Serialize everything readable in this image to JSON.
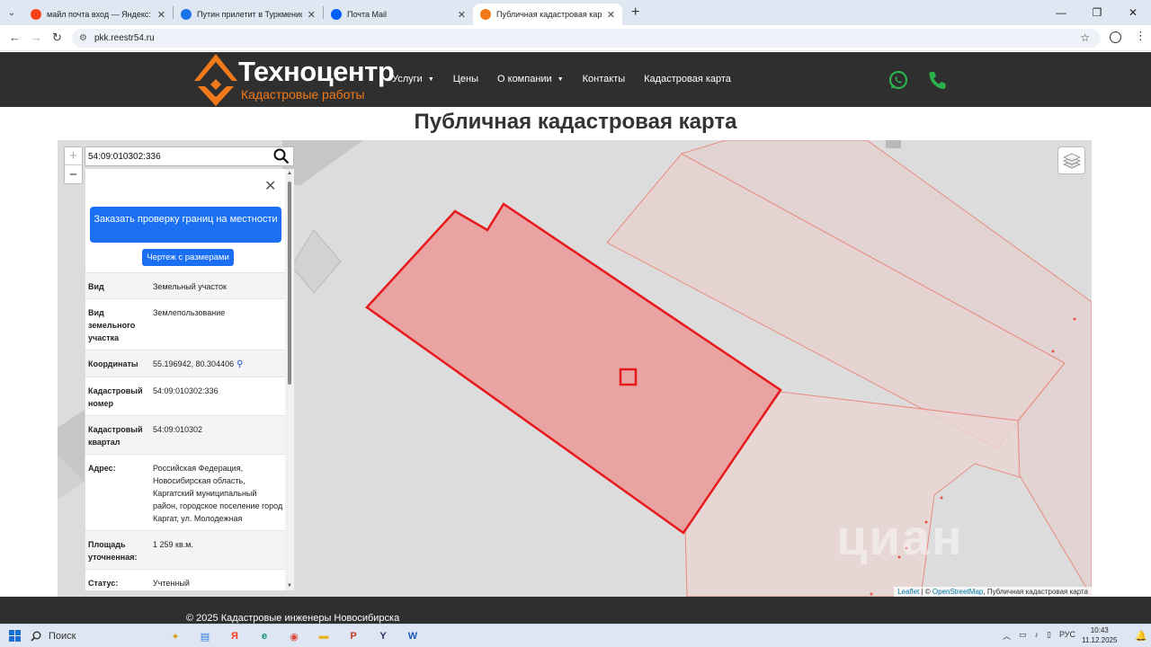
{
  "browser": {
    "tabs": [
      {
        "title": "майл почта вход — Яндекс: на",
        "icon": "yandex-icon",
        "color": "#fc3f1d"
      },
      {
        "title": "Путин прилетит в Туркменис",
        "icon": "news-icon",
        "color": "#1a73e8"
      },
      {
        "title": "Почта Mail",
        "icon": "mail-icon",
        "color": "#005ff9"
      },
      {
        "title": "Публичная кадастровая карта",
        "icon": "site-icon",
        "color": "#f07a1a",
        "active": true
      }
    ],
    "new_tab": "+",
    "url": "pkk.reestr54.ru"
  },
  "site": {
    "brand": "Техноцентр",
    "brand_sub": "Кадастровые работы",
    "accent": "#f07a1a",
    "menu": [
      {
        "label": "Услуги",
        "dropdown": true
      },
      {
        "label": "Цены",
        "dropdown": false
      },
      {
        "label": "О компании",
        "dropdown": true
      },
      {
        "label": "Контакты",
        "dropdown": false
      },
      {
        "label": "Кадастровая карта",
        "dropdown": false
      }
    ],
    "contact_color": "#2bb24c"
  },
  "page": {
    "title": "Публичная кадастровая карта"
  },
  "map": {
    "search_value": "54:09:010302:336",
    "zoom_in": "+",
    "zoom_out": "−",
    "panel": {
      "order_button": "Заказать проверку границ на местности",
      "drawing_button": "Чертеж с размерами",
      "rows": [
        {
          "key": "Вид",
          "value": "Земельный участок"
        },
        {
          "key": "Вид земельного участка",
          "value": "Землепользование"
        },
        {
          "key": "Координаты",
          "value": "55.196942, 80.304406"
        },
        {
          "key": "Кадастровый номер",
          "value": "54:09:010302:336"
        },
        {
          "key": "Кадастровый квартал",
          "value": "54:09:010302"
        },
        {
          "key": "Адрес:",
          "value": "Российская Федерация, Новосибирская область, Каргатский муниципальный район, городское поселение город Каргат, ул. Молодежная"
        },
        {
          "key": "Площадь уточненная:",
          "value": "1 259 кв.м."
        },
        {
          "key": "Статус:",
          "value": "Учтенный"
        }
      ]
    },
    "attribution": {
      "leaflet": "Leaflet",
      "sep": " | © ",
      "osm": "OpenStreetMap",
      "rest": ", Публичная кадастровая карта"
    },
    "watermark": "циан",
    "parcel_color": "#e8191c"
  },
  "footer": {
    "copyright": "© 2025 Кадастровые инженеры Новосибирска"
  },
  "taskbar": {
    "search_label": "Поиск",
    "apps": [
      {
        "name": "copilot-icon",
        "glyph": "✦",
        "color": "#d4a017"
      },
      {
        "name": "files-icon",
        "glyph": "▤",
        "color": "#2a7ad5"
      },
      {
        "name": "yandex-browser-icon",
        "glyph": "Я",
        "color": "#fc3f1d"
      },
      {
        "name": "edge-icon",
        "glyph": "e",
        "color": "#0c8e7b"
      },
      {
        "name": "chrome-icon",
        "glyph": "◉",
        "color": "#db4437"
      },
      {
        "name": "explorer-icon",
        "glyph": "▬",
        "color": "#e8b423"
      },
      {
        "name": "powerpoint-icon",
        "glyph": "P",
        "color": "#c43e1c"
      },
      {
        "name": "yandex-icon",
        "glyph": "Y",
        "color": "#33306b"
      },
      {
        "name": "word-icon",
        "glyph": "W",
        "color": "#185abd"
      }
    ],
    "lang": "РУС",
    "time": "10:43",
    "date": "11.12.2025"
  }
}
